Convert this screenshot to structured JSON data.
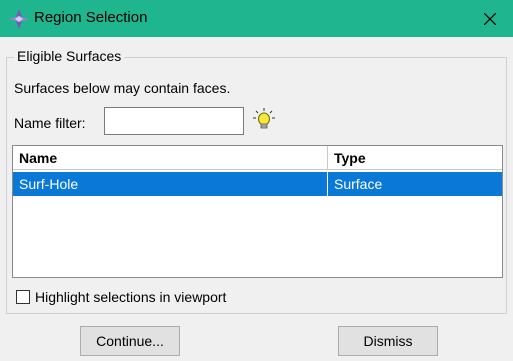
{
  "window": {
    "title": "Region Selection",
    "title_bar_color": "#1fb58f",
    "app_icon": "abaqus-diamond-icon",
    "close_icon": "close-icon"
  },
  "group": {
    "legend": "Eligible Surfaces",
    "description": "Surfaces below may contain faces."
  },
  "filter": {
    "label": "Name filter:",
    "value": "",
    "icon": "lightbulb-icon"
  },
  "table": {
    "columns": [
      "Name",
      "Type"
    ],
    "rows": [
      {
        "name": "Surf-Hole",
        "type": "Surface",
        "selected": true
      }
    ],
    "selection_color": "#0a78d7"
  },
  "highlight": {
    "label": "Highlight selections in viewport",
    "checked": false
  },
  "buttons": {
    "continue": "Continue...",
    "dismiss": "Dismiss"
  }
}
